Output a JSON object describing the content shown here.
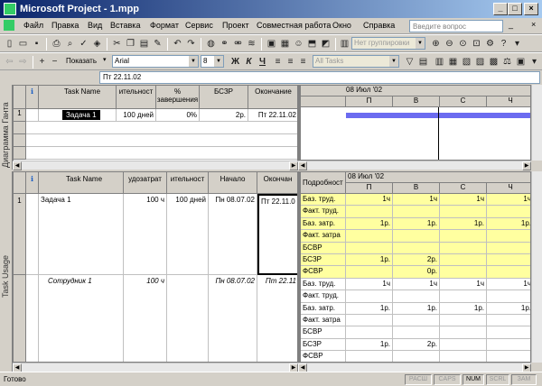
{
  "window": {
    "title": "Microsoft Project - 1.mpp",
    "minimize": "_",
    "maximize": "□",
    "close": "×"
  },
  "menu": [
    "Файл",
    "Правка",
    "Вид",
    "Вставка",
    "Формат",
    "Сервис",
    "Проект",
    "Совместная работа",
    "Окно",
    "Справка"
  ],
  "ask_placeholder": "Введите вопрос",
  "toolbar1": {
    "grouping": "Нет группировки"
  },
  "toolbar2": {
    "show_label": "Показать",
    "font": "Arial",
    "size": "8",
    "bold": "Ж",
    "italic": "К",
    "underline": "Ч",
    "filter": "All Tasks"
  },
  "entry": {
    "value": "Пт 22.11.02"
  },
  "gantt": {
    "side_label": "Диаграмма Ганта",
    "headers": [
      "",
      "ℹ",
      "Task Name",
      "ительност",
      "% завершения",
      "БСЗР",
      "Окончание"
    ],
    "row": {
      "id": "1",
      "name": "Задача 1",
      "duration": "100 дней",
      "pct": "0%",
      "bczr": "2р.",
      "finish": "Пт 22.11.02"
    },
    "timescale": {
      "week": "08 Июл '02",
      "days": [
        "П",
        "В",
        "С",
        "Ч"
      ]
    }
  },
  "usage": {
    "side_label": "Task Usage",
    "headers": [
      "",
      "ℹ",
      "Task Name",
      "удозатрат",
      "ительност",
      "Начало",
      "Окончан"
    ],
    "task": {
      "id": "1",
      "name": "Задача 1",
      "work": "100 ч",
      "duration": "100 дней",
      "start": "Пн 08.07.02",
      "finish": "Пт 22.11.0"
    },
    "assign": {
      "name": "Сотрудник 1",
      "work": "100 ч",
      "start": "Пн 08.07.02",
      "finish": "Пт 22.11"
    },
    "details_header": "Подробност",
    "timescale": {
      "week": "08 Июл '02",
      "days": [
        "П",
        "В",
        "С",
        "Ч"
      ]
    },
    "detail_rows": [
      {
        "label": "Баз. труд.",
        "vals": [
          "1ч",
          "1ч",
          "1ч",
          "1ч"
        ],
        "yellow": true
      },
      {
        "label": "Факт. труд.",
        "vals": [
          "",
          "",
          "",
          ""
        ],
        "yellow": true
      },
      {
        "label": "Баз. затр.",
        "vals": [
          "1р.",
          "1р.",
          "1р.",
          "1р."
        ],
        "yellow": true
      },
      {
        "label": "Факт. затра",
        "vals": [
          "",
          "",
          "",
          ""
        ],
        "yellow": true
      },
      {
        "label": "БСВР",
        "vals": [
          "",
          "",
          "",
          ""
        ],
        "yellow": true
      },
      {
        "label": "БСЗР",
        "vals": [
          "1р.",
          "2р.",
          "",
          ""
        ],
        "yellow": true
      },
      {
        "label": "ФСВР",
        "vals": [
          "",
          "0р.",
          "",
          ""
        ],
        "yellow": true
      },
      {
        "label": "Баз. труд.",
        "vals": [
          "1ч",
          "1ч",
          "1ч",
          "1ч"
        ],
        "yellow": false
      },
      {
        "label": "Факт. труд.",
        "vals": [
          "",
          "",
          "",
          ""
        ],
        "yellow": false
      },
      {
        "label": "Баз. затр.",
        "vals": [
          "1р.",
          "1р.",
          "1р.",
          "1р."
        ],
        "yellow": false
      },
      {
        "label": "Факт. затра",
        "vals": [
          "",
          "",
          "",
          ""
        ],
        "yellow": false
      },
      {
        "label": "БСВР",
        "vals": [
          "",
          "",
          "",
          ""
        ],
        "yellow": false
      },
      {
        "label": "БСЗР",
        "vals": [
          "1р.",
          "2р.",
          "",
          ""
        ],
        "yellow": false
      },
      {
        "label": "ФСВР",
        "vals": [
          "",
          "",
          "",
          ""
        ],
        "yellow": false
      }
    ]
  },
  "status": {
    "ready": "Готово",
    "indicators": [
      "РАСШ",
      "CAPS",
      "NUM",
      "SCRL",
      "ЗАМ"
    ]
  },
  "colors": {
    "title_start": "#0a246a",
    "gantt_bar": "#6b6bf0",
    "detail_yellow": "#ffffa0"
  }
}
